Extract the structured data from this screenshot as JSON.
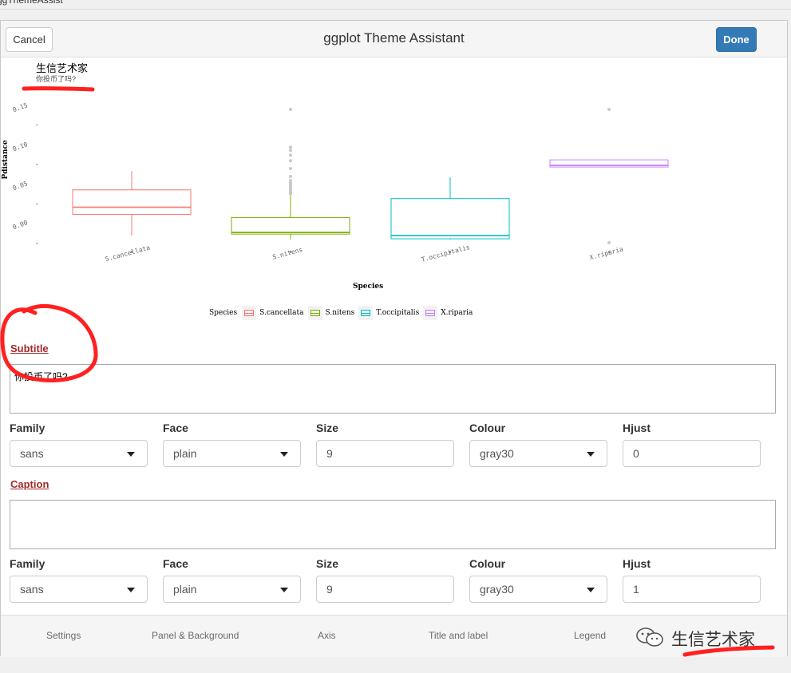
{
  "window": {
    "title": "ggThemeAssist"
  },
  "header": {
    "cancel_label": "Cancel",
    "title": "ggplot Theme Assistant",
    "done_label": "Done"
  },
  "plot": {
    "title": "生信艺术家",
    "subtitle": "你投币了吗?",
    "ylabel": "Pdistance",
    "xlabel": "Species",
    "y_ticks": [
      "0.15",
      "0.10",
      "0.05",
      "0.00"
    ],
    "legend_title": "Species"
  },
  "chart_data": {
    "type": "box",
    "xlabel": "Species",
    "ylabel": "Pdistance",
    "ylim": [
      -0.003,
      0.172
    ],
    "categories": [
      "S.cancellata",
      "S.nitens",
      "T.occipitalis",
      "X.riparia"
    ],
    "colors": [
      "#F8766D",
      "#7CAE00",
      "#00BFC4",
      "#C77CFF"
    ],
    "boxes": [
      {
        "name": "S.cancellata",
        "lower_whisker": 0.01,
        "q1": 0.037,
        "median": 0.046,
        "q3": 0.068,
        "upper_whisker": 0.092,
        "outliers": []
      },
      {
        "name": "S.nitens",
        "lower_whisker": 0.005,
        "q1": 0.012,
        "median": 0.014,
        "q3": 0.033,
        "upper_whisker": 0.062,
        "outliers": [
          0.063,
          0.065,
          0.067,
          0.069,
          0.071,
          0.073,
          0.075,
          0.077,
          0.08,
          0.085,
          0.095,
          0.105,
          0.112,
          0.118,
          0.122,
          0.17
        ]
      },
      {
        "name": "T.occipitalis",
        "lower_whisker": 0.005,
        "q1": 0.006,
        "median": 0.01,
        "q3": 0.057,
        "upper_whisker": 0.084,
        "outliers": []
      },
      {
        "name": "X.riparia",
        "lower_whisker": 0.097,
        "q1": 0.097,
        "median": 0.099,
        "q3": 0.106,
        "upper_whisker": 0.106,
        "outliers": [
          0.17,
          0.001
        ]
      }
    ],
    "legend_position": "bottom"
  },
  "subtitle_section": {
    "label": "Subtitle",
    "text": "你投币了吗?",
    "fields": {
      "family_label": "Family",
      "family": "sans",
      "face_label": "Face",
      "face": "plain",
      "size_label": "Size",
      "size": "9",
      "colour_label": "Colour",
      "colour": "gray30",
      "hjust_label": "Hjust",
      "hjust": "0"
    }
  },
  "caption_section": {
    "label": "Caption",
    "text": "",
    "fields": {
      "family_label": "Family",
      "family": "sans",
      "face_label": "Face",
      "face": "plain",
      "size_label": "Size",
      "size": "9",
      "colour_label": "Colour",
      "colour": "gray30",
      "hjust_label": "Hjust",
      "hjust": "1"
    }
  },
  "footer": {
    "tabs": [
      "Settings",
      "Panel & Background",
      "Axis",
      "Title and label",
      "Legend"
    ],
    "watermark": "生信艺术家"
  },
  "colors": {
    "accent": "#337ab7",
    "section_label": "#a52a2a",
    "annotation": "#ff2020"
  },
  "icons": {
    "dropdown": "caret-down-icon",
    "watermark": "wechat-icon"
  }
}
